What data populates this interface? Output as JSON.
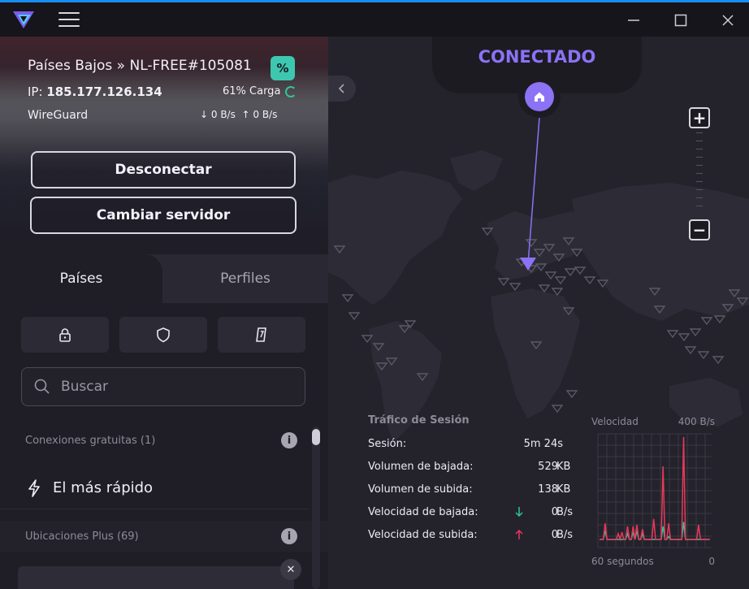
{
  "window": {
    "minimize_icon": "minimize-icon",
    "maximize_icon": "maximize-icon",
    "close_icon": "close-icon"
  },
  "connection": {
    "server": "Países Bajos » NL-FREE#105081",
    "ip_prefix": "IP: ",
    "ip": "185.177.126.134",
    "load": "61% Carga",
    "protocol": "WireGuard",
    "down_speed": "↓ 0 B/s",
    "up_speed": "↑ 0 B/s",
    "disconnect_label": "Desconectar",
    "change_server_label": "Cambiar servidor"
  },
  "tabs": {
    "countries": "Países",
    "profiles": "Perfiles"
  },
  "search": {
    "placeholder": "Buscar"
  },
  "list": {
    "free_header": "Conexiones gratuitas (1)",
    "fastest_label": "El más rápido",
    "plus_header": "Ubicaciones Plus (69)"
  },
  "map": {
    "status": "CONECTADO",
    "zoom_in": "+",
    "zoom_out": "−"
  },
  "session_stats": {
    "title": "Tráfico de Sesión",
    "rows": [
      {
        "label": "Sesión:",
        "value": "5m 24s",
        "unit": ""
      },
      {
        "label": "Volumen de bajada:",
        "value": "529",
        "unit": "KB"
      },
      {
        "label": "Volumen de subida:",
        "value": "138",
        "unit": "KB"
      },
      {
        "label": "Velocidad de bajada:",
        "value": "0",
        "unit": "B/s"
      },
      {
        "label": "Velocidad de subida:",
        "value": "0",
        "unit": "B/s"
      }
    ]
  },
  "speed_chart": {
    "title": "Velocidad",
    "max_label": "400 B/s",
    "x_start_label": "60 segundos",
    "x_end_label": "0",
    "colors": {
      "download": "#2ec49a",
      "upload": "#e8385a",
      "grid": "#3a3944"
    }
  }
}
